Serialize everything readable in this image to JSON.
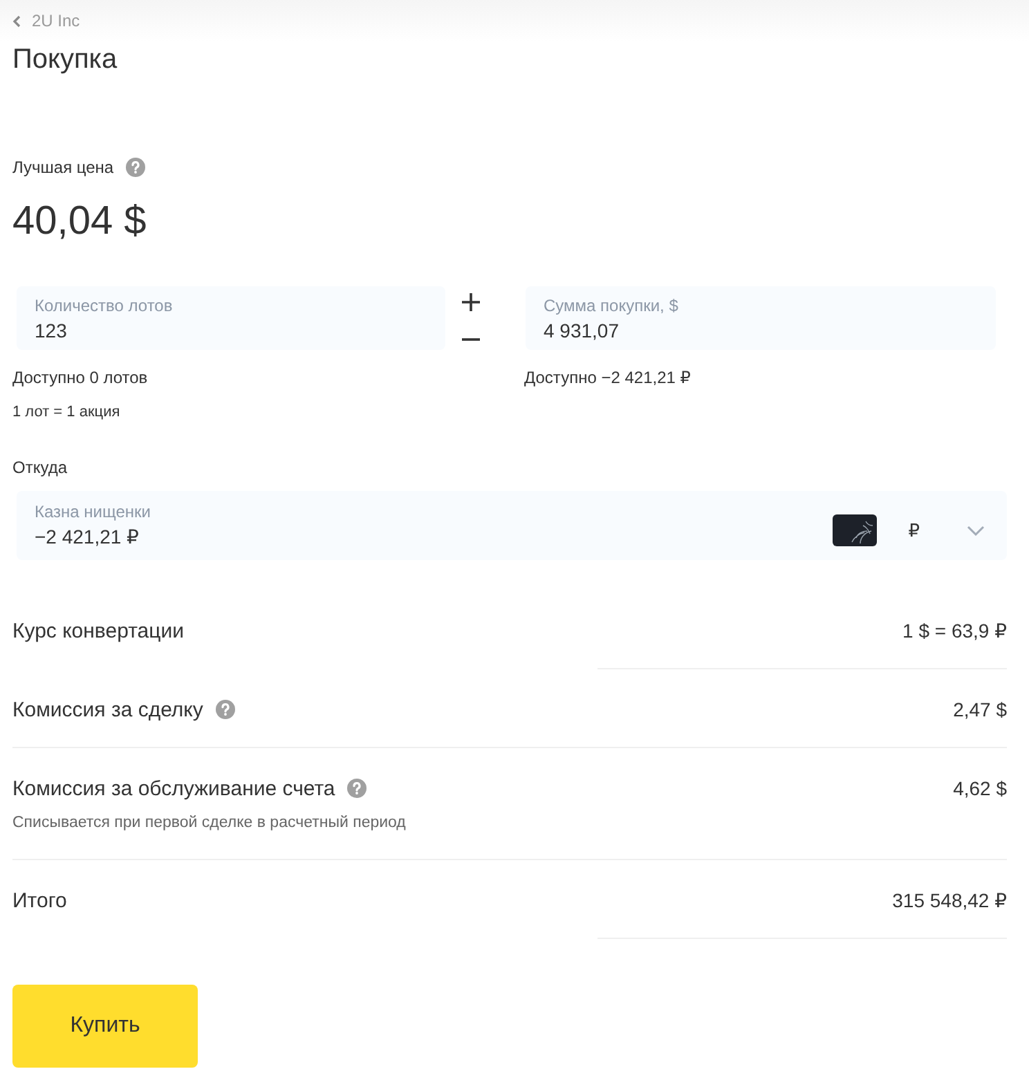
{
  "breadcrumb": {
    "label": "2U Inc"
  },
  "title": "Покупка",
  "best_price": {
    "label": "Лучшая цена",
    "has_help": true,
    "value": "40,04 $"
  },
  "lots_field": {
    "label": "Количество лотов",
    "value": "123"
  },
  "amount_field": {
    "label": "Сумма покупки, $",
    "value": "4 931,07"
  },
  "available_lots": "Доступно 0 лотов",
  "available_funds": "Доступно −2 421,21 ₽",
  "lot_note": "1 лот = 1 акция",
  "source": {
    "label": "Откуда",
    "account_name": "Казна нищенки",
    "balance": "−2 421,21 ₽",
    "currency": "₽"
  },
  "summary": [
    {
      "label": "Курс конвертации",
      "value": "1 $ = 63,9 ₽",
      "has_help": false
    },
    {
      "label": "Комиссия за сделку",
      "value": "2,47 $",
      "has_help": true
    },
    {
      "label": "Комиссия за обслуживание счета",
      "value": "4,62 $",
      "has_help": true,
      "note": "Списывается при первой сделке в расчетный период"
    },
    {
      "label": "Итого",
      "value": "315 548,42 ₽",
      "has_help": false
    }
  ],
  "buy_button": "Купить"
}
